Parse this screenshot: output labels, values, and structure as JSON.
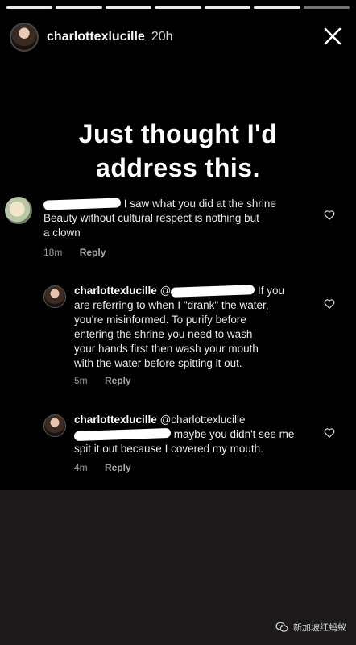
{
  "story": {
    "segments": [
      true,
      true,
      true,
      true,
      true,
      true,
      false
    ],
    "username": "charlottexlucille",
    "time": "20h",
    "close_icon": "close-icon"
  },
  "headline": {
    "line1": "Just thought I'd",
    "line2": "address this."
  },
  "comments": [
    {
      "line1": "I saw what you did at the shrine",
      "line2": "Beauty without cultural respect is nothing but",
      "line3": "a clown",
      "time": "18m",
      "reply": "Reply"
    },
    {
      "author": "charlottexlucille",
      "mention_prefix": "@",
      "line1_tail": "If you",
      "line2": "are referring to when I \"drank\" the water,",
      "line3": "you're misinformed. To purify before",
      "line4": "entering the shrine you need to wash",
      "line5": "your hands first then wash your mouth",
      "line6": "with the water before spitting it out.",
      "time": "5m",
      "reply": "Reply"
    },
    {
      "author": "charlottexlucille",
      "mention": "@charlottexlucille",
      "line2_tail": "maybe you didn't see me",
      "line3": "spit it out because I covered my mouth.",
      "time": "4m",
      "reply": "Reply"
    }
  ],
  "watermark": {
    "text": "新加坡红蚂蚁"
  }
}
